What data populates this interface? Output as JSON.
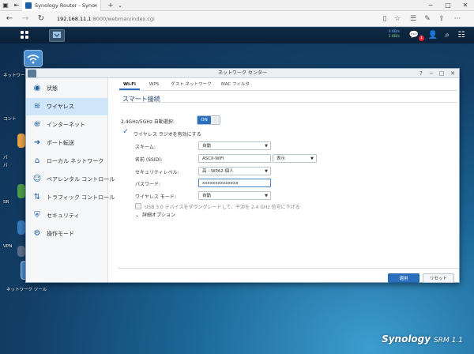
{
  "browser": {
    "tab_title": "Synology Router - Syno",
    "tab_close": "×",
    "new_tab": "+",
    "tab_list": "⌄",
    "url_host": "192.168.11.1",
    "url_path": ":8000/webman/index.cgi"
  },
  "taskbar": {
    "upload_rate": "0 KB/s",
    "download_rate": "1 KB/s",
    "notification_count": "1"
  },
  "desktop": {
    "icons": [
      {
        "label": "ネットワー",
        "color": "#4b8fd1"
      },
      {
        "label": "コント",
        "color": "#4f6f8f"
      },
      {
        "label": "パ",
        "color": "#e9a545"
      },
      {
        "label": "パ",
        "color": "#b9c6d2"
      },
      {
        "label": "SR",
        "color": "#4d9e4a"
      },
      {
        "label": "",
        "color": "#3a7cc0"
      },
      {
        "label": "VPN",
        "color": "#5d6e86"
      },
      {
        "label": "ネットワーク ツール",
        "color": "#4b8fd1"
      }
    ],
    "brand_name": "Synology",
    "brand_suffix": "SRM 1.1"
  },
  "window": {
    "title": "ネットワーク センター",
    "sidebar": [
      {
        "label": "状態",
        "icon": "status-icon",
        "glyph": "◉"
      },
      {
        "label": "ワイヤレス",
        "icon": "wifi-icon",
        "glyph": "≋"
      },
      {
        "label": "インターネット",
        "icon": "globe-icon",
        "glyph": "⊕"
      },
      {
        "label": "ポート転送",
        "icon": "arrow-icon",
        "glyph": "➜"
      },
      {
        "label": "ローカル ネットワーク",
        "icon": "network-icon",
        "glyph": "⌂"
      },
      {
        "label": "ペアレンタル コントロール",
        "icon": "parental-icon",
        "glyph": "☺"
      },
      {
        "label": "トラフィック コントロール",
        "icon": "traffic-icon",
        "glyph": "⇅"
      },
      {
        "label": "セキュリティ",
        "icon": "shield-icon",
        "glyph": "⛨"
      },
      {
        "label": "操作モード",
        "icon": "mode-icon",
        "glyph": "⚙"
      }
    ],
    "tabs": [
      "Wi-Fi",
      "WPS",
      "ゲスト ネットワーク",
      "MAC フィルタ"
    ],
    "section_title": "スマート接続",
    "band_label": "2.4GHz/5GHz 自動選択:",
    "toggle_value": "ON",
    "radio_enable_label": "ワイヤレス ラジオを有効にする",
    "schedule_label": "スキーム:",
    "schedule_value": "自動",
    "ssid_label": "名前 (SSID):",
    "ssid_value": "ASCII-WiFi",
    "visibility_value": "表示",
    "security_label": "セキュリティレベル:",
    "security_value": "高 - WPA2-個人",
    "password_label": "パスワード:",
    "password_value": "xxxxxxxxxxxxxx",
    "mode_label": "ワイヤレス モード:",
    "mode_value": "自動",
    "usb_label": "USB 3.0 デバイスをダウングレードして、干渉を 2.4 GHz 信号に下げる",
    "advanced_label": "詳細オプション",
    "apply_label": "適用",
    "reset_label": "リセット"
  }
}
